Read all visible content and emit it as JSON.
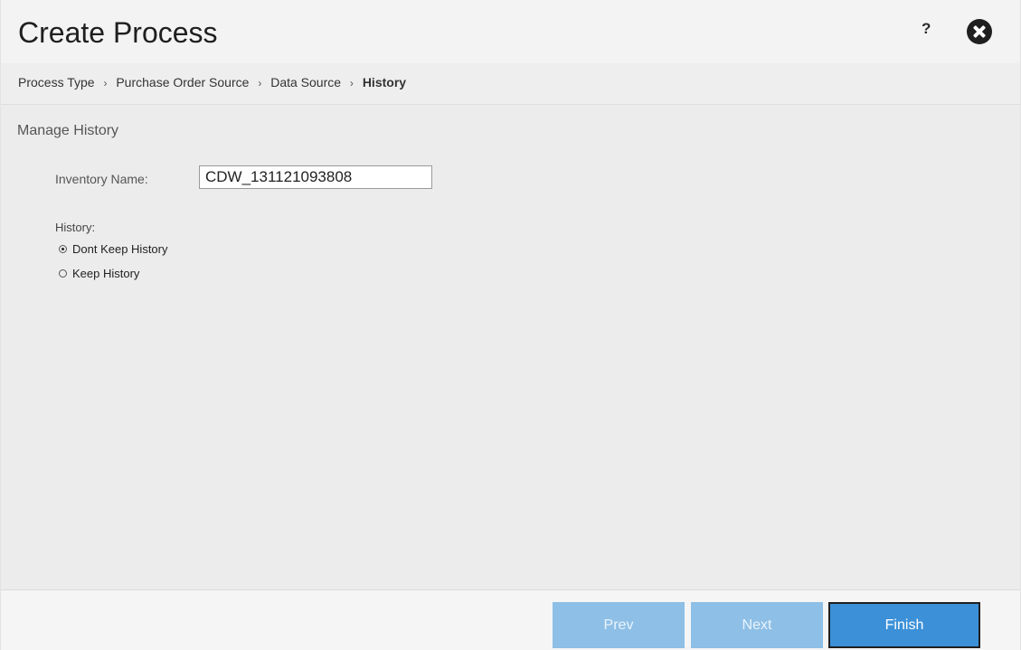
{
  "dialog": {
    "title": "Create Process",
    "help_glyph": "?",
    "icons": [
      "help-icon",
      "close-icon"
    ]
  },
  "breadcrumb": {
    "items": [
      {
        "label": "Process Type"
      },
      {
        "label": "Purchase Order Source"
      },
      {
        "label": "Data Source"
      },
      {
        "label": "History"
      }
    ],
    "separator": "›"
  },
  "main": {
    "section_title": "Manage History",
    "inventory": {
      "label": "Inventory Name:",
      "value": "CDW_131121093808"
    },
    "history": {
      "label": "History:",
      "options": [
        {
          "label": "Dont Keep History",
          "selected": true
        },
        {
          "label": "Keep History",
          "selected": false
        }
      ]
    }
  },
  "footer": {
    "prev_label": "Prev",
    "next_label": "Next",
    "finish_label": "Finish"
  },
  "colors": {
    "accent": "#3b90d8",
    "disabled_button": "#8ebfe6"
  }
}
